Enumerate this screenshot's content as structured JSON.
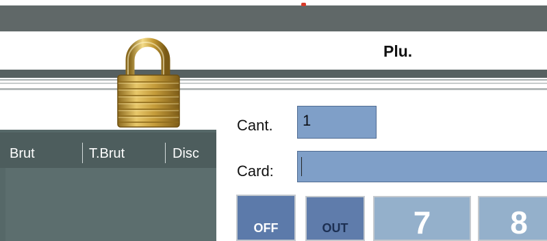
{
  "header": {
    "title": "Plu."
  },
  "table": {
    "columns": [
      "Brut",
      "T.Brut",
      "Disc"
    ]
  },
  "form": {
    "cant_label": "Cant.",
    "cant_value": "1",
    "card_label": "Card:",
    "card_value": ""
  },
  "keypad": {
    "keys": [
      "OFF",
      "OUT",
      "7",
      "8"
    ]
  },
  "colors": {
    "top_bar": "#606868",
    "input_fill": "#7f9fc8",
    "key_dark": "#5c7aaa",
    "key_light": "#94b0cb",
    "lock_gold": "#c9a13c"
  },
  "icons": {
    "lock": "padlock-icon"
  }
}
